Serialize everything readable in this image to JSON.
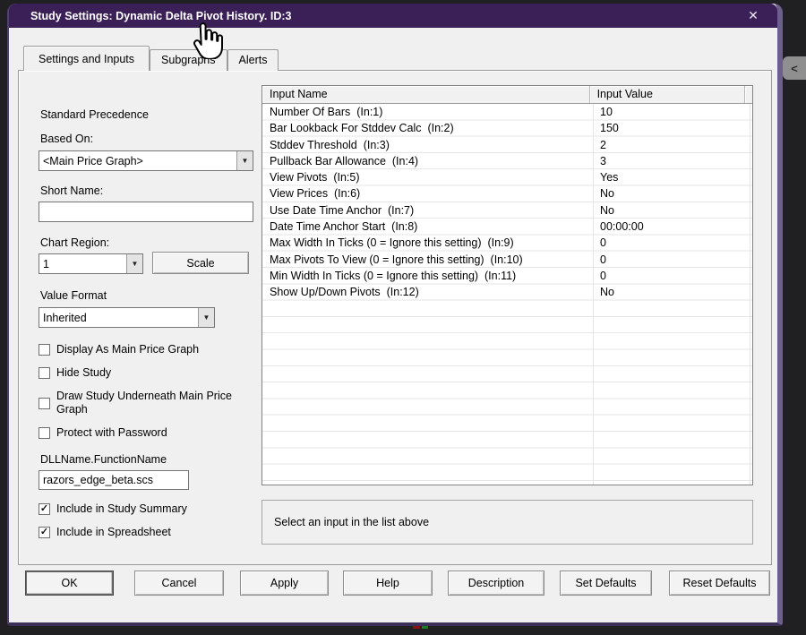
{
  "window": {
    "title": "Study Settings: Dynamic Delta Pivot History. ID:3"
  },
  "icons": {
    "close_glyph": "✕",
    "dropdown_glyph": "▼",
    "check_glyph": "✓",
    "collapse_glyph": "<",
    "cursor": "hand-pointer"
  },
  "tabs": [
    {
      "label": "Settings and Inputs",
      "active": true
    },
    {
      "label": "Subgraphs",
      "active": false
    },
    {
      "label": "Alerts",
      "active": false
    }
  ],
  "left_panel": {
    "precedence_label": "Standard Precedence",
    "based_on_label": "Based On:",
    "based_on_value": "<Main Price Graph>",
    "short_name_label": "Short Name:",
    "short_name_value": "",
    "chart_region_label": "Chart Region:",
    "chart_region_value": "1",
    "scale_button_label": "Scale",
    "value_format_label": "Value Format",
    "value_format_value": "Inherited",
    "checkboxes": [
      {
        "label": "Display As Main Price Graph",
        "checked": false
      },
      {
        "label": "Hide Study",
        "checked": false
      },
      {
        "label": "Draw Study Underneath Main Price Graph",
        "checked": false
      },
      {
        "label": "Protect with Password",
        "checked": false
      }
    ],
    "dll_label": "DLLName.FunctionName",
    "dll_value": "razors_edge_beta.scs",
    "include_checkboxes": [
      {
        "label": "Include in Study Summary",
        "checked": true
      },
      {
        "label": "Include in Spreadsheet",
        "checked": true
      }
    ]
  },
  "inputs_table": {
    "columns": [
      "Input Name",
      "Input Value"
    ],
    "rows": [
      {
        "name": "Number Of Bars  (In:1)",
        "value": "10"
      },
      {
        "name": "Bar Lookback For Stddev Calc  (In:2)",
        "value": "150"
      },
      {
        "name": "Stddev Threshold  (In:3)",
        "value": "2"
      },
      {
        "name": "Pullback Bar Allowance  (In:4)",
        "value": "3"
      },
      {
        "name": "View Pivots  (In:5)",
        "value": "Yes"
      },
      {
        "name": "View Prices  (In:6)",
        "value": "No"
      },
      {
        "name": "Use Date Time Anchor  (In:7)",
        "value": "No"
      },
      {
        "name": "Date Time Anchor Start  (In:8)",
        "value": "00:00:00"
      },
      {
        "name": "Max Width In Ticks (0 = Ignore this setting)  (In:9)",
        "value": "0"
      },
      {
        "name": "Max Pivots To View (0 = Ignore this setting)  (In:10)",
        "value": "0"
      },
      {
        "name": "Min Width In Ticks (0 = Ignore this setting)  (In:11)",
        "value": "0"
      },
      {
        "name": "Show Up/Down Pivots  (In:12)",
        "value": "No"
      }
    ],
    "hint": "Select an input in the list above"
  },
  "buttons": [
    "OK",
    "Cancel",
    "Apply",
    "Help",
    "Description",
    "Set Defaults",
    "Reset Defaults"
  ],
  "colors": {
    "titlebar": "#3a2056",
    "dialog_border": "#6a5f8d",
    "dialog_bg": "#f0f0f0",
    "background": "#202023"
  }
}
